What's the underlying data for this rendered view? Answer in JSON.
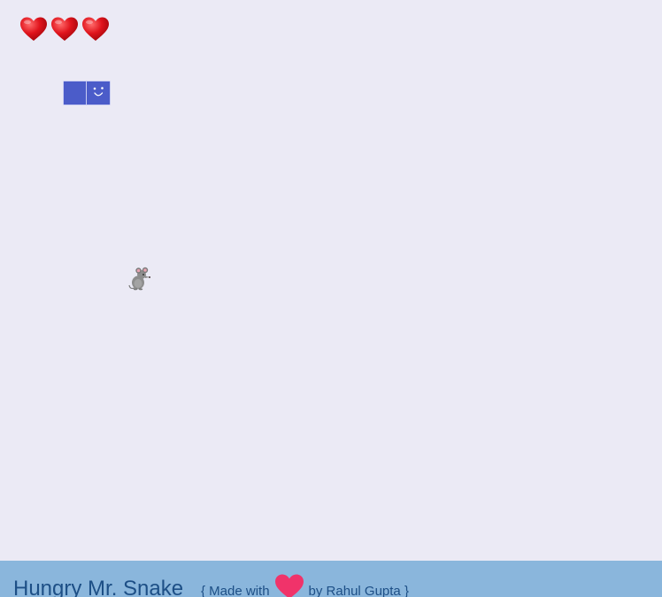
{
  "game": {
    "lives": 3,
    "hearts": [
      "heart-icon",
      "heart-icon",
      "heart-icon"
    ],
    "snake_length": 2,
    "colors": {
      "board": "#ebeaf5",
      "snake": "#4b5cc9",
      "heart": "#d9131a",
      "footer": "#8ab6dc",
      "footer_text": "#1d4f86",
      "credit_heart": "#f0336a"
    }
  },
  "footer": {
    "title": "Hungry Mr. Snake",
    "credit_prefix": "{ Made with",
    "credit_icon": "heart-icon",
    "credit_suffix": "by Rahul Gupta }"
  }
}
